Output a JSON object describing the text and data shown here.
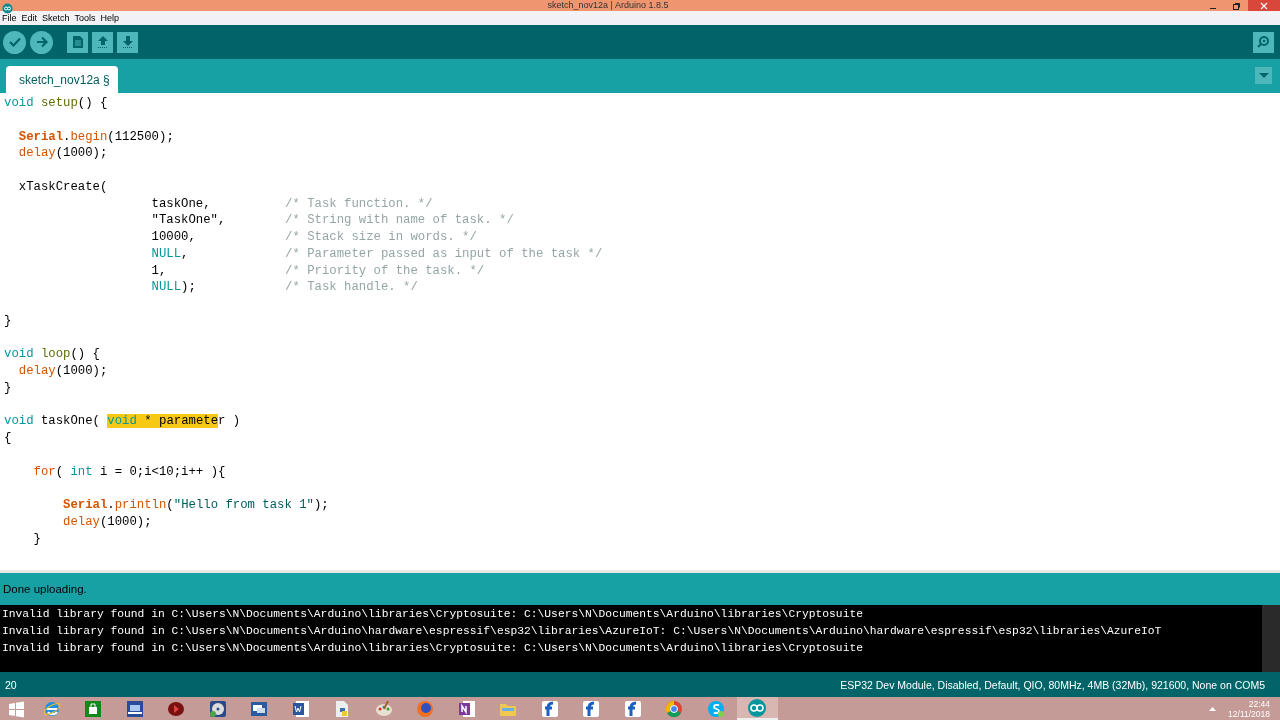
{
  "window": {
    "title": "sketch_nov12a | Arduino 1.8.5"
  },
  "menu": [
    "File",
    "Edit",
    "Sketch",
    "Tools",
    "Help"
  ],
  "tabs": [
    {
      "label": "sketch_nov12a §",
      "selected": true
    }
  ],
  "editor": {
    "lines": [
      {
        "kind": "code",
        "tokens": [
          {
            "kind": "kw",
            "text": "void"
          },
          {
            "kind": "entry",
            "text": " setup"
          },
          {
            "kind": "plain",
            "text": "() {"
          }
        ]
      },
      {
        "kind": "blank"
      },
      {
        "kind": "code",
        "tokens": [
          {
            "kind": "cls",
            "text": "  Serial"
          },
          {
            "kind": "plain",
            "text": "."
          },
          {
            "kind": "fn",
            "text": "begin"
          },
          {
            "kind": "plain",
            "text": "(112500);"
          }
        ]
      },
      {
        "kind": "code",
        "tokens": [
          {
            "kind": "fn",
            "text": "  delay"
          },
          {
            "kind": "plain",
            "text": "(1000);"
          }
        ]
      },
      {
        "kind": "blank"
      },
      {
        "kind": "code",
        "tokens": [
          {
            "kind": "plain",
            "text": "  xTaskCreate("
          }
        ]
      },
      {
        "kind": "code",
        "tokens": [
          {
            "kind": "plain",
            "text": "                    taskOne,"
          }
        ],
        "comment": "/* Task function. */"
      },
      {
        "kind": "code",
        "tokens": [
          {
            "kind": "plain",
            "text": "                    \"TaskOne\","
          }
        ],
        "comment": "/* String with name of task. */"
      },
      {
        "kind": "code",
        "tokens": [
          {
            "kind": "plain",
            "text": "                    10000,"
          }
        ],
        "comment": "/* Stack size in words. */"
      },
      {
        "kind": "code",
        "tokens": [
          {
            "kind": "kw",
            "text": "                    NULL"
          },
          {
            "kind": "plain",
            "text": ","
          }
        ],
        "comment": "/* Parameter passed as input of the task */"
      },
      {
        "kind": "code",
        "tokens": [
          {
            "kind": "plain",
            "text": "                    1,"
          }
        ],
        "comment": "/* Priority of the task. */"
      },
      {
        "kind": "code",
        "tokens": [
          {
            "kind": "kw",
            "text": "                    NULL"
          },
          {
            "kind": "plain",
            "text": ");"
          }
        ],
        "comment": "/* Task handle. */"
      },
      {
        "kind": "blank"
      },
      {
        "kind": "code",
        "tokens": [
          {
            "kind": "plain",
            "text": "}"
          }
        ]
      },
      {
        "kind": "blank"
      },
      {
        "kind": "code",
        "tokens": [
          {
            "kind": "kw",
            "text": "void"
          },
          {
            "kind": "entry",
            "text": " loop"
          },
          {
            "kind": "plain",
            "text": "() {"
          }
        ]
      },
      {
        "kind": "code",
        "tokens": [
          {
            "kind": "fn",
            "text": "  delay"
          },
          {
            "kind": "plain",
            "text": "(1000);"
          }
        ]
      },
      {
        "kind": "code",
        "tokens": [
          {
            "kind": "plain",
            "text": "}"
          }
        ]
      },
      {
        "kind": "blank"
      },
      {
        "kind": "code",
        "tokens": [
          {
            "kind": "kw",
            "text": "void"
          },
          {
            "kind": "plain",
            "text": " taskOne( "
          },
          {
            "kind": "kw",
            "text": "void",
            "highlighted": true
          },
          {
            "kind": "plain",
            "text": " * paramete",
            "highlighted": true
          },
          {
            "kind": "plain",
            "text": "r )"
          }
        ]
      },
      {
        "kind": "code",
        "tokens": [
          {
            "kind": "plain",
            "text": "{"
          }
        ]
      },
      {
        "kind": "blank"
      },
      {
        "kind": "code",
        "tokens": [
          {
            "kind": "fn",
            "text": "    for"
          },
          {
            "kind": "plain",
            "text": "( "
          },
          {
            "kind": "kw",
            "text": "int"
          },
          {
            "kind": "plain",
            "text": " i = 0;i<10;i++ ){"
          }
        ]
      },
      {
        "kind": "blank"
      },
      {
        "kind": "code",
        "tokens": [
          {
            "kind": "cls",
            "text": "        Serial"
          },
          {
            "kind": "plain",
            "text": "."
          },
          {
            "kind": "fn",
            "text": "println"
          },
          {
            "kind": "plain",
            "text": "("
          },
          {
            "kind": "str",
            "text": "\"Hello from task 1\""
          },
          {
            "kind": "plain",
            "text": ");"
          }
        ]
      },
      {
        "kind": "code",
        "tokens": [
          {
            "kind": "fn",
            "text": "        delay"
          },
          {
            "kind": "plain",
            "text": "(1000);"
          }
        ]
      },
      {
        "kind": "code",
        "tokens": [
          {
            "kind": "plain",
            "text": "    }"
          }
        ]
      }
    ]
  },
  "status": {
    "message": "Done uploading."
  },
  "console": {
    "lines": [
      "Invalid library found in C:\\Users\\N\\Documents\\Arduino\\libraries\\Cryptosuite: C:\\Users\\N\\Documents\\Arduino\\libraries\\Cryptosuite",
      "Invalid library found in C:\\Users\\N\\Documents\\Arduino\\hardware\\espressif\\esp32\\libraries\\AzureIoT: C:\\Users\\N\\Documents\\Arduino\\hardware\\espressif\\esp32\\libraries\\AzureIoT",
      "Invalid library found in C:\\Users\\N\\Documents\\Arduino\\libraries\\Cryptosuite: C:\\Users\\N\\Documents\\Arduino\\libraries\\Cryptosuite"
    ]
  },
  "status_bar": {
    "line": "20",
    "board": "ESP32 Dev Module, Disabled, Default, QIO, 80MHz, 4MB (32Mb), 921600, None on COM5"
  },
  "taskbar": {
    "apps": [
      {
        "active": false
      },
      {
        "active": false
      },
      {
        "active": false
      },
      {
        "active": false
      },
      {
        "active": false
      },
      {
        "active": false
      },
      {
        "active": false
      },
      {
        "active": false
      },
      {
        "active": false
      },
      {
        "active": false
      },
      {
        "active": false
      },
      {
        "active": false
      },
      {
        "active": false
      },
      {
        "active": false
      },
      {
        "active": false
      },
      {
        "active": false
      },
      {
        "active": false
      },
      {
        "active": true
      }
    ],
    "time": "22:44",
    "date": "12/11/2018"
  }
}
